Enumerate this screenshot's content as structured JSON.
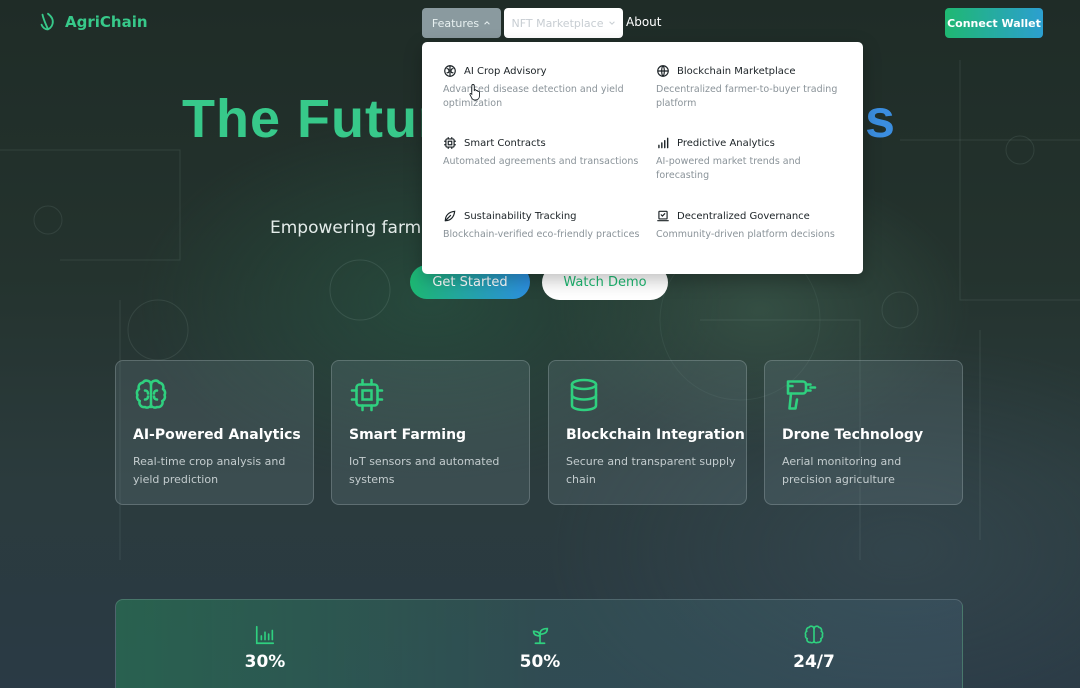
{
  "header": {
    "brand": "AgriChain",
    "nav": {
      "features": "Features",
      "nft_marketplace": "NFT Marketplace",
      "about": "About"
    },
    "connect_wallet": "Connect Wallet"
  },
  "features_menu": [
    {
      "icon": "brain-icon",
      "title": "AI Crop Advisory",
      "description": "Advanced disease detection and yield optimization"
    },
    {
      "icon": "globe-icon",
      "title": "Blockchain Marketplace",
      "description": "Decentralized farmer-to-buyer trading platform"
    },
    {
      "icon": "chip-icon",
      "title": "Smart Contracts",
      "description": "Automated agreements and transactions"
    },
    {
      "icon": "bar-chart-icon",
      "title": "Predictive Analytics",
      "description": "AI-powered market trends and forecasting"
    },
    {
      "icon": "leaf-icon",
      "title": "Sustainability Tracking",
      "description": "Blockchain-verified eco-friendly practices"
    },
    {
      "icon": "vote-icon",
      "title": "Decentralized Governance",
      "description": "Community-driven platform decisions"
    }
  ],
  "hero": {
    "title_left": "The Futur",
    "title_right": "s",
    "subtitle": "Empowering farme",
    "primary_cta": "Get Started",
    "secondary_cta": "Watch Demo"
  },
  "cards": [
    {
      "icon": "brain-icon",
      "title": "AI-Powered Analytics",
      "description": "Real-time crop analysis and yield prediction"
    },
    {
      "icon": "chip-icon",
      "title": "Smart Farming",
      "description": "IoT sensors and automated systems"
    },
    {
      "icon": "database-icon",
      "title": "Blockchain Integration",
      "description": "Secure and transparent supply chain"
    },
    {
      "icon": "drill-icon",
      "title": "Drone Technology",
      "description": "Aerial monitoring and precision agriculture"
    }
  ],
  "stats": [
    {
      "icon": "bar-chart-icon",
      "value": "30%"
    },
    {
      "icon": "sprout-icon",
      "value": "50%"
    },
    {
      "icon": "brain-icon",
      "value": "24/7"
    }
  ],
  "colors": {
    "brand_green": "#37c98a",
    "brand_blue": "#3b8ee0",
    "features_button": "#8a9a9f"
  }
}
